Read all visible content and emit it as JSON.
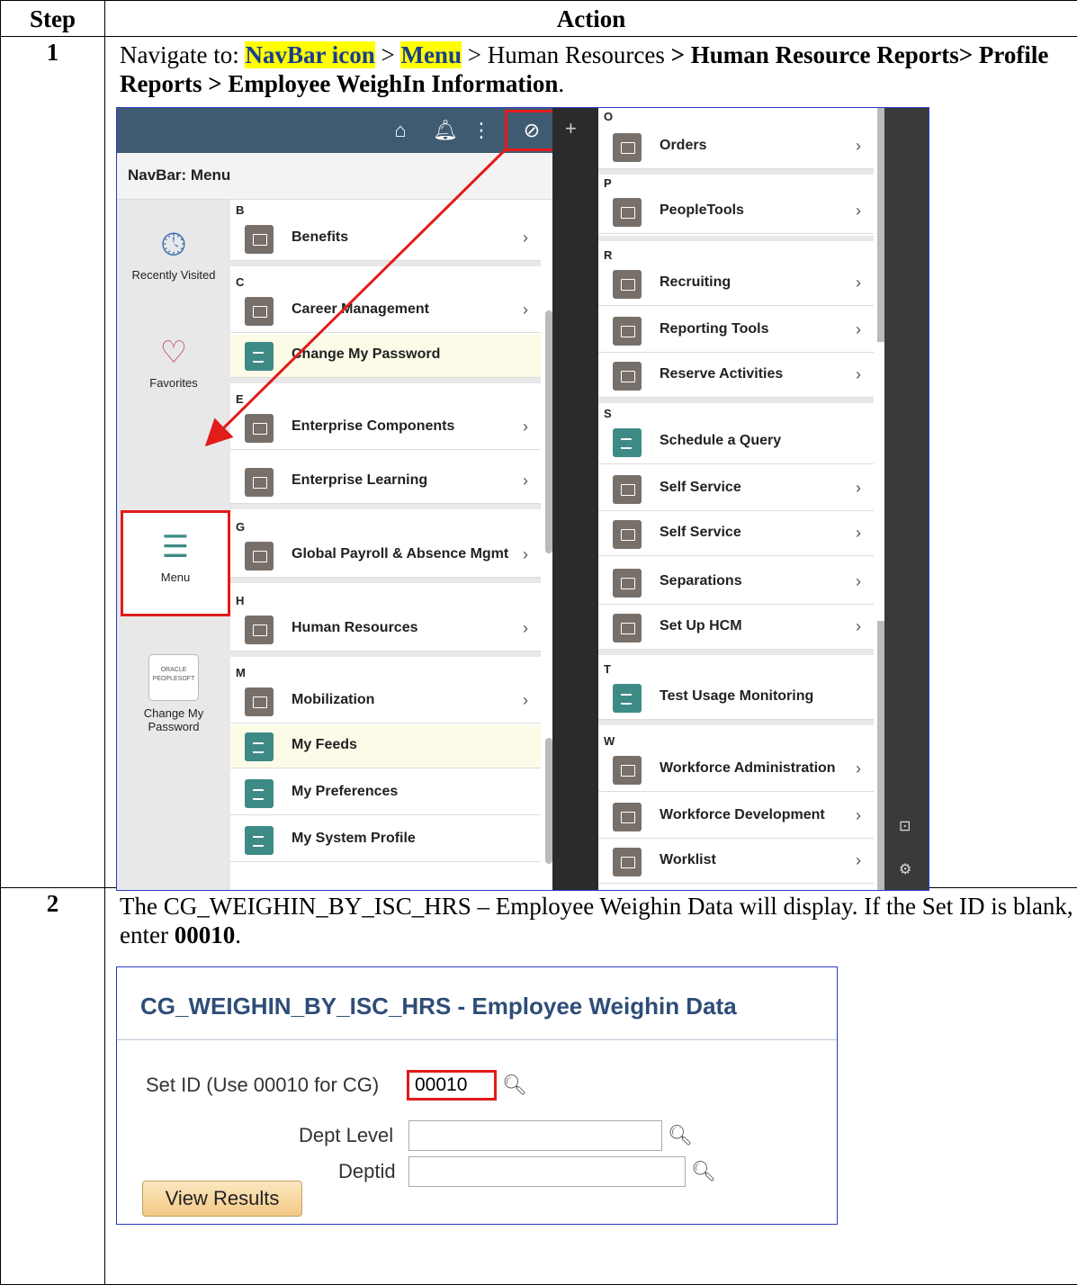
{
  "table": {
    "col_step": "Step",
    "col_action": "Action"
  },
  "steps": [
    {
      "num": "1",
      "text_a": "Navigate to: ",
      "hl1": "NavBar icon",
      "text_b": " > ",
      "hl2": "Menu",
      "text_c": " > Human Resources ",
      "bold1": "> Human Resource Reports> Profile Reports > Employee WeighIn Information",
      "text_d": "."
    },
    {
      "num": "2",
      "text_a": "The CG_WEIGHIN_BY_ISC_HRS – Employee Weighin Data will display.  If the Set ID is blank, enter ",
      "bold1": "00010",
      "text_b": "."
    }
  ],
  "navbar": {
    "title": "NavBar: Menu",
    "side": [
      {
        "label": "Recently Visited",
        "icon": "clock-icon"
      },
      {
        "label": "Favorites",
        "icon": "heart-icon"
      },
      {
        "label": "Menu",
        "icon": "menu-icon"
      },
      {
        "label_1": "Change My",
        "label_2": "Password",
        "icon": "oracle-logo",
        "logo_1": "ORACLE",
        "logo_2": "PEOPLESOFT"
      }
    ],
    "groups_left": [
      {
        "letter": "B",
        "items": [
          {
            "label": "Benefits",
            "type": "folder"
          }
        ]
      },
      {
        "letter": "C",
        "items": [
          {
            "label": "Career Management",
            "type": "folder"
          },
          {
            "label": "Change My Password",
            "type": "content"
          }
        ]
      },
      {
        "letter": "E",
        "items": [
          {
            "label": "Enterprise Components",
            "type": "folder"
          },
          {
            "label": "Enterprise Learning",
            "type": "folder"
          }
        ]
      },
      {
        "letter": "G",
        "items": [
          {
            "label": "Global Payroll & Absence Mgmt",
            "type": "folder"
          }
        ]
      },
      {
        "letter": "H",
        "items": [
          {
            "label": "Human Resources",
            "type": "folder"
          }
        ]
      },
      {
        "letter": "M",
        "items": [
          {
            "label": "Mobilization",
            "type": "folder"
          },
          {
            "label": "My Feeds",
            "type": "content"
          },
          {
            "label": "My Preferences",
            "type": "content"
          },
          {
            "label": "My System Profile",
            "type": "content"
          }
        ]
      }
    ],
    "groups_right": [
      {
        "letter": "O",
        "items": [
          {
            "label": "Orders",
            "type": "folder"
          }
        ]
      },
      {
        "letter": "P",
        "items": [
          {
            "label": "PeopleTools",
            "type": "folder"
          }
        ]
      },
      {
        "letter": "R",
        "items": [
          {
            "label": "Recruiting",
            "type": "folder"
          },
          {
            "label": "Reporting Tools",
            "type": "folder"
          },
          {
            "label": "Reserve Activities",
            "type": "folder"
          }
        ]
      },
      {
        "letter": "S",
        "items": [
          {
            "label": "Schedule a Query",
            "type": "content"
          },
          {
            "label": "Self Service",
            "type": "folder"
          },
          {
            "label": "Self Service",
            "type": "folder"
          },
          {
            "label": "Separations",
            "type": "folder"
          },
          {
            "label": "Set Up HCM",
            "type": "folder"
          }
        ]
      },
      {
        "letter": "T",
        "items": [
          {
            "label": "Test Usage Monitoring",
            "type": "content"
          }
        ]
      },
      {
        "letter": "W",
        "items": [
          {
            "label": "Workforce Administration",
            "type": "folder"
          },
          {
            "label": "Workforce Development",
            "type": "folder"
          },
          {
            "label": "Worklist",
            "type": "folder"
          }
        ]
      }
    ],
    "colors": {
      "header": "#3f5b72",
      "folder": "#77706a",
      "content": "#3d8a86",
      "highlight": "#e21b1b"
    }
  },
  "weighin": {
    "title": "CG_WEIGHIN_BY_ISC_HRS - Employee Weighin Data",
    "setid_label": "Set ID (Use 00010 for CG)",
    "setid_value": "00010",
    "dept_level_label": "Dept Level",
    "dept_level_value": "",
    "deptid_label": "Deptid",
    "deptid_value": "",
    "view_button": "View Results"
  }
}
